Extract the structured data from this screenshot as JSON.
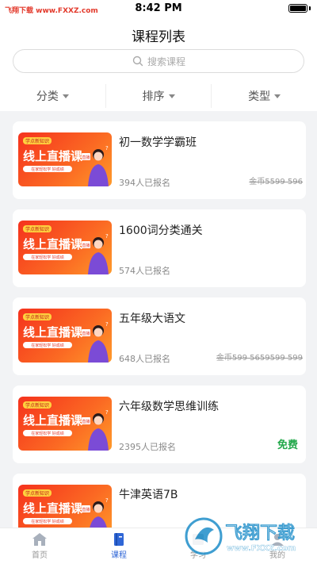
{
  "status_bar": {
    "time": "8:42 PM",
    "watermark": "飞翔下载 www.FXXZ.com"
  },
  "header": {
    "title": "课程列表"
  },
  "search": {
    "placeholder": "搜索课程"
  },
  "filters": [
    {
      "label": "分类"
    },
    {
      "label": "排序"
    },
    {
      "label": "类型"
    }
  ],
  "courses": [
    {
      "title": "初一数学学霸班",
      "enrolled": "394人已报名",
      "price": "金币5599 596",
      "price_type": "struck"
    },
    {
      "title": "1600词分类通关",
      "enrolled": "574人已报名",
      "price": "",
      "price_type": "none"
    },
    {
      "title": "五年级大语文",
      "enrolled": "648人已报名",
      "price": "金币599 5659599 599",
      "price_type": "struck"
    },
    {
      "title": "六年级数学思维训练",
      "enrolled": "2395人已报名",
      "price": "免费",
      "price_type": "free"
    },
    {
      "title": "牛津英语7B",
      "enrolled": "",
      "price": "",
      "price_type": "none"
    }
  ],
  "thumbnail": {
    "headline": "线上直播课",
    "tag": "学点新知识",
    "badge": "直播",
    "subline": "在家轻松学 好成绩"
  },
  "tabs": [
    {
      "label": "首页",
      "icon": "home-icon"
    },
    {
      "label": "课程",
      "icon": "book-icon"
    },
    {
      "label": "学习",
      "icon": "study-icon"
    },
    {
      "label": "我的",
      "icon": "profile-icon"
    }
  ],
  "watermark": {
    "text": "飞翔下载",
    "url": "www.FXXZ.com"
  },
  "colors": {
    "accent": "#2f66d6",
    "free": "#22a84a",
    "thumb_orange": "#f5321d"
  }
}
